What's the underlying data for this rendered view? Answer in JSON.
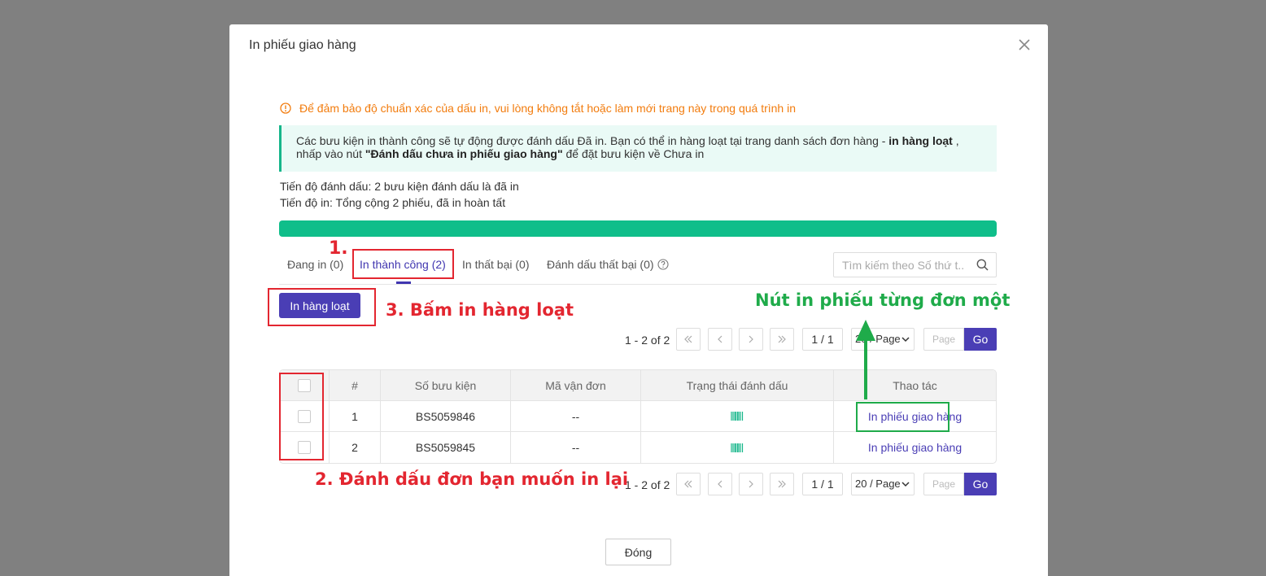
{
  "modal": {
    "title": "In phiếu giao hàng",
    "warning": "Để đảm bảo độ chuẩn xác của dấu in, vui lòng không tắt hoặc làm mới trang này trong quá trình in",
    "info_part1": "Các bưu kiện in thành công sẽ tự động được đánh dấu Đã in. Bạn có thể in hàng loạt tại trang danh sách đơn hàng - ",
    "info_bold1": "in hàng loạt",
    "info_part2": " , nhấp vào nút ",
    "info_bold2": "\"Đánh dấu chưa in phiếu giao hàng\"",
    "info_part3": " để đặt bưu kiện về Chưa in",
    "progress_mark": "Tiến độ đánh dấu: 2 bưu kiện đánh dấu là đã in",
    "progress_print": "Tiến độ in: Tổng cộng 2 phiếu, đã in hoàn tất",
    "progress_percent": 100,
    "accent_color": "#4a3eb5",
    "progress_color": "#0fbe8a"
  },
  "tabs": [
    {
      "label": "Đang in (0)"
    },
    {
      "label": "In thành công (2)"
    },
    {
      "label": "In thất bại (0)"
    },
    {
      "label": "Đánh dấu thất bại (0)"
    }
  ],
  "search": {
    "placeholder": "Tìm kiếm theo Số thứ t..."
  },
  "bulk_print_label": "In hàng loạt",
  "pagination": {
    "count": "1 - 2 of 2",
    "page_info": "1 / 1",
    "page_size": "20 / Page",
    "page_placeholder": "Page",
    "go": "Go"
  },
  "table": {
    "headers": [
      "#",
      "Số bưu kiện",
      "Mã vận đơn",
      "Trạng thái đánh dấu",
      "Thao tác"
    ],
    "rows": [
      {
        "index": "1",
        "parcel": "BS5059846",
        "tracking": "--",
        "action": "In phiếu giao hàng"
      },
      {
        "index": "2",
        "parcel": "BS5059845",
        "tracking": "--",
        "action": "In phiếu giao hàng"
      }
    ]
  },
  "close_label": "Đóng",
  "annotations": {
    "step1": "1.",
    "step2": "2. Đánh dấu đơn bạn muốn in lại",
    "step3": "3. Bấm in hàng loạt",
    "single_print": "Nút in phiếu từng đơn một"
  }
}
